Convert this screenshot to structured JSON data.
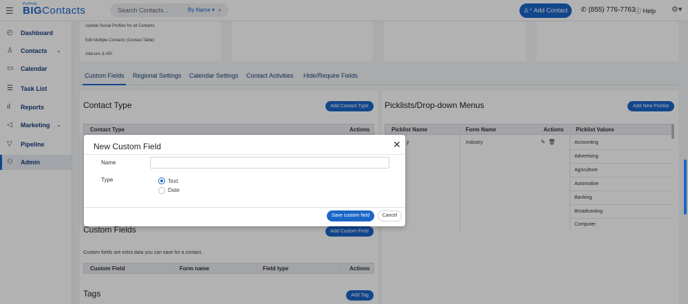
{
  "header": {
    "logo_small": "ProProfs",
    "logo_big_bold": "BIG",
    "logo_big_rest": "Contacts",
    "search_placeholder": "Search Contacts...",
    "search_by": "By Name ▾",
    "add_contact": "Add Contact",
    "phone": "(855) 776-7763",
    "help": "Help"
  },
  "sidebar": {
    "items": [
      {
        "label": "Dashboard",
        "icon": "◴"
      },
      {
        "label": "Contacts",
        "icon": "♙"
      },
      {
        "label": "Calendar",
        "icon": "▭"
      },
      {
        "label": "Task List",
        "icon": "☰"
      },
      {
        "label": "Reports",
        "icon": "ıl"
      },
      {
        "label": "Marketing",
        "icon": "◁"
      },
      {
        "label": "Pipeline",
        "icon": "▽"
      },
      {
        "label": "Admin",
        "icon": "⚇"
      }
    ]
  },
  "top_links": [
    "Update Social Profiles for all Contacts",
    "Edit Multiple Contacts (Contact Table)",
    "Add-ons & API"
  ],
  "tabs": [
    "Custom Fields",
    "Regional Settings",
    "Calendar Settings",
    "Contact Activities",
    "Hide/Require Fields"
  ],
  "contact_type": {
    "title": "Contact Type",
    "add_button": "Add Contact Type",
    "col_type": "Contact Type",
    "col_actions": "Actions"
  },
  "custom_fields": {
    "title": "Custom Fields",
    "add_button": "Add Custom Field",
    "description": "Custom fields are extra data you can save for a contact.",
    "cols": [
      "Custom Field",
      "Form name",
      "Field type",
      "Actions"
    ]
  },
  "tags": {
    "title": "Tags",
    "add_button": "Add Tag"
  },
  "picklists": {
    "title": "Picklists/Drop-down Menus",
    "add_button": "Add New Picklist",
    "cols": [
      "Picklist Name",
      "Form Name",
      "Actions",
      "Picklist Values"
    ],
    "row_name_partial": "y",
    "row_form": "Industry",
    "values": [
      "Accounting",
      "Advertising",
      "Agriculture",
      "Automotive",
      "Banking",
      "Broadcasting",
      "Computer"
    ]
  },
  "modal": {
    "title": "New Custom Field",
    "close": "✕",
    "name_label": "Name",
    "type_label": "Type",
    "opt_text": "Text",
    "opt_date": "Date",
    "save": "Save custom field",
    "cancel": "Cancel"
  }
}
